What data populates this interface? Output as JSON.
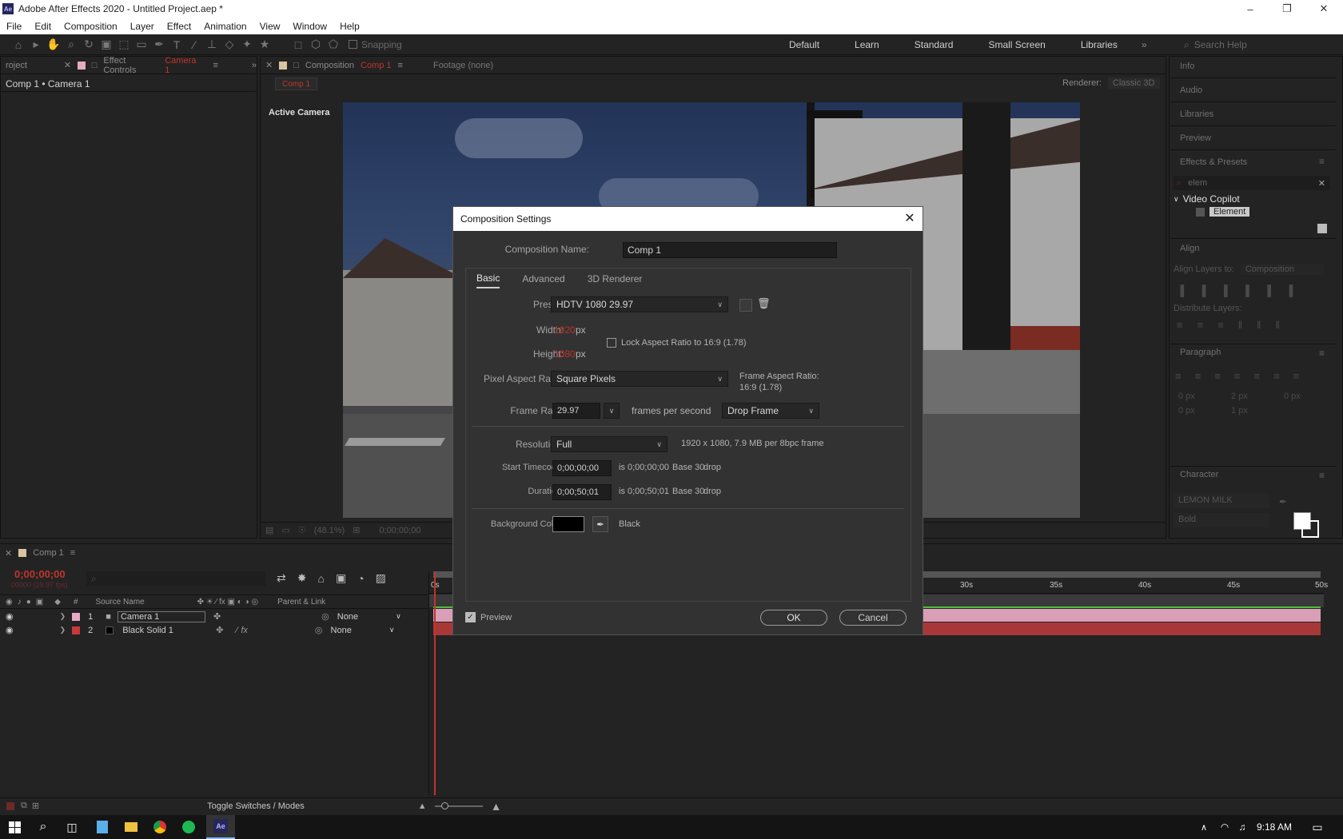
{
  "window": {
    "title": "Adobe After Effects 2020 - Untitled Project.aep *",
    "app_badge": "Ae"
  },
  "menu": [
    "File",
    "Edit",
    "Composition",
    "Layer",
    "Effect",
    "Animation",
    "View",
    "Window",
    "Help"
  ],
  "toolbar": {
    "snapping_label": "Snapping"
  },
  "workspaces": [
    "Default",
    "Learn",
    "Standard",
    "Small Screen",
    "Libraries"
  ],
  "search_help": {
    "placeholder": "Search Help"
  },
  "left_panel": {
    "tab_project": "roject",
    "tab_effect_controls": "Effect Controls",
    "effect_controls_target": "Camera 1",
    "header": "Comp 1 • Camera 1"
  },
  "comp_panel": {
    "tab_label": "Composition",
    "tab_target": "Comp 1",
    "footage_tab": "Footage (none)",
    "breadcrumb": "Comp 1",
    "renderer_label": "Renderer:",
    "renderer_value": "Classic 3D",
    "active_camera": "Active Camera",
    "zoom": "(48.1%)",
    "timecode": "0;00;00;00"
  },
  "right_panel": {
    "sections": [
      "Info",
      "Audio",
      "Libraries",
      "Preview",
      "Effects & Presets"
    ],
    "effects_search": "elem",
    "effects_group": "Video Copilot",
    "effects_item": "Element",
    "align_title": "Align",
    "align_layers_to_label": "Align Layers to:",
    "align_layers_to_value": "Composition",
    "distribute_label": "Distribute Layers:",
    "paragraph_title": "Paragraph",
    "para_values": [
      "0 px",
      "2 px",
      "0 px",
      "0 px",
      "1 px"
    ],
    "character_title": "Character",
    "font_name": "LEMON MILK",
    "font_style": "Bold"
  },
  "dialog": {
    "title": "Composition Settings",
    "comp_name_label": "Composition Name:",
    "comp_name_value": "Comp 1",
    "tabs": [
      "Basic",
      "Advanced",
      "3D Renderer"
    ],
    "preset_label": "Preset:",
    "preset_value": "HDTV 1080 29.97",
    "width_label": "Width:",
    "width_value": "1920",
    "height_label": "Height:",
    "height_value": "1080",
    "px": "px",
    "lock_label": "Lock Aspect Ratio to 16:9 (1.78)",
    "par_label": "Pixel Aspect Ratio:",
    "par_value": "Square Pixels",
    "far_label": "Frame Aspect Ratio:",
    "far_value": "16:9 (1.78)",
    "fr_label": "Frame Rate:",
    "fr_value": "29.97",
    "fps_label": "frames per second",
    "drop_value": "Drop Frame",
    "res_label": "Resolution:",
    "res_value": "Full",
    "res_info": "1920 x 1080, 7.9 MB per 8bpc frame",
    "start_label": "Start Timecode:",
    "start_value": "0;00;00;00",
    "start_info": "is 0;00;00;00",
    "base": "Base 30",
    "drop": "drop",
    "dur_label": "Duration:",
    "dur_value": "0;00;50;01",
    "dur_info": "is 0;00;50;01",
    "bg_label": "Background Color:",
    "bg_name": "Black",
    "bg_color": "#000000",
    "preview_label": "Preview",
    "ok_label": "OK",
    "cancel_label": "Cancel"
  },
  "timeline": {
    "tab": "Comp 1",
    "timecode": "0;00;00;00",
    "timecode_sub": "00000 (29.97 fps)",
    "col_num": "#",
    "col_source": "Source Name",
    "col_parent": "Parent & Link",
    "layers": [
      {
        "num": "1",
        "name": "Camera 1",
        "parent": "None",
        "color": "#e8a9c3"
      },
      {
        "num": "2",
        "name": "Black Solid 1",
        "parent": "None",
        "color": "#c9393a"
      }
    ],
    "ruler": [
      "0s",
      "30s",
      "35s",
      "40s",
      "45s",
      "50s"
    ],
    "toggle_label": "Toggle Switches / Modes"
  },
  "taskbar": {
    "time": "9:18 AM",
    "ae_badge": "Ae"
  }
}
